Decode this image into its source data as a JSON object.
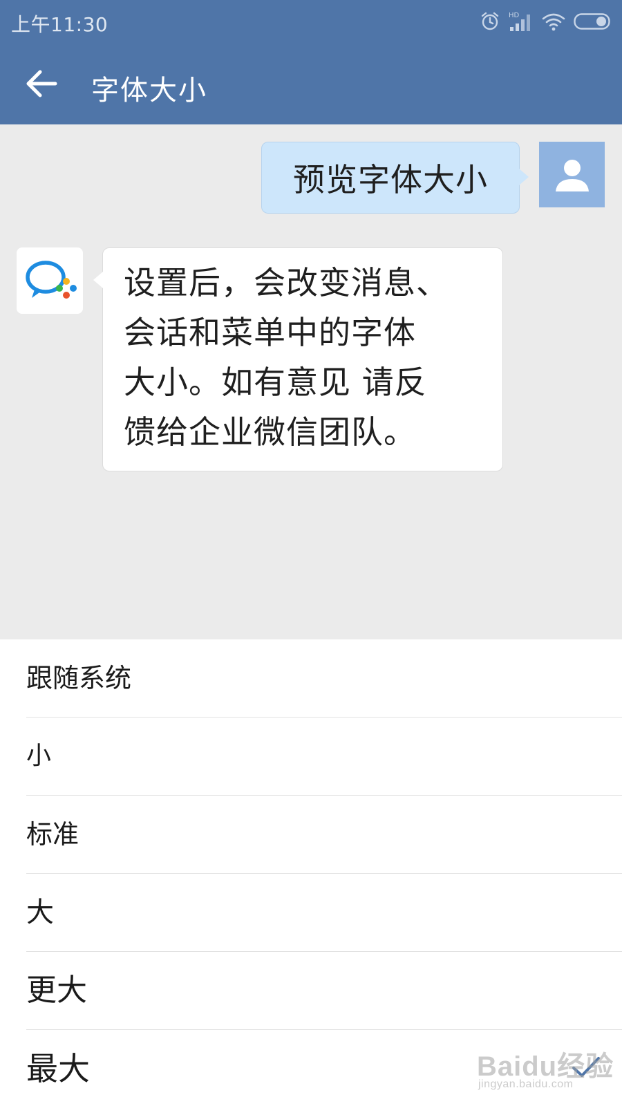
{
  "status_bar": {
    "time": "上午11:30",
    "icons": [
      "alarm-icon",
      "hd-signal-icon",
      "wifi-icon",
      "battery-icon"
    ],
    "hd_label": "HD"
  },
  "app_bar": {
    "title": "字体大小",
    "back_icon": "arrow-left-icon"
  },
  "chat": {
    "user_message": "预览字体大小",
    "bot_message_lines": [
      "设置后，会改变消息、",
      "会话和菜单中的字体",
      "大小。如有意见 请反",
      "馈给企业微信团队。"
    ]
  },
  "options": {
    "items": [
      {
        "label": "跟随系统",
        "selected": false
      },
      {
        "label": "小",
        "selected": false
      },
      {
        "label": "标准",
        "selected": false
      },
      {
        "label": "大",
        "selected": false
      },
      {
        "label": "更大",
        "selected": false
      },
      {
        "label": "最大",
        "selected": true
      }
    ]
  },
  "watermark": {
    "main": "Baidu经验",
    "sub": "jingyan.baidu.com"
  },
  "colors": {
    "header": "#4f75a8",
    "user_bubble": "#cde6fb",
    "check": "#4f75a8"
  }
}
